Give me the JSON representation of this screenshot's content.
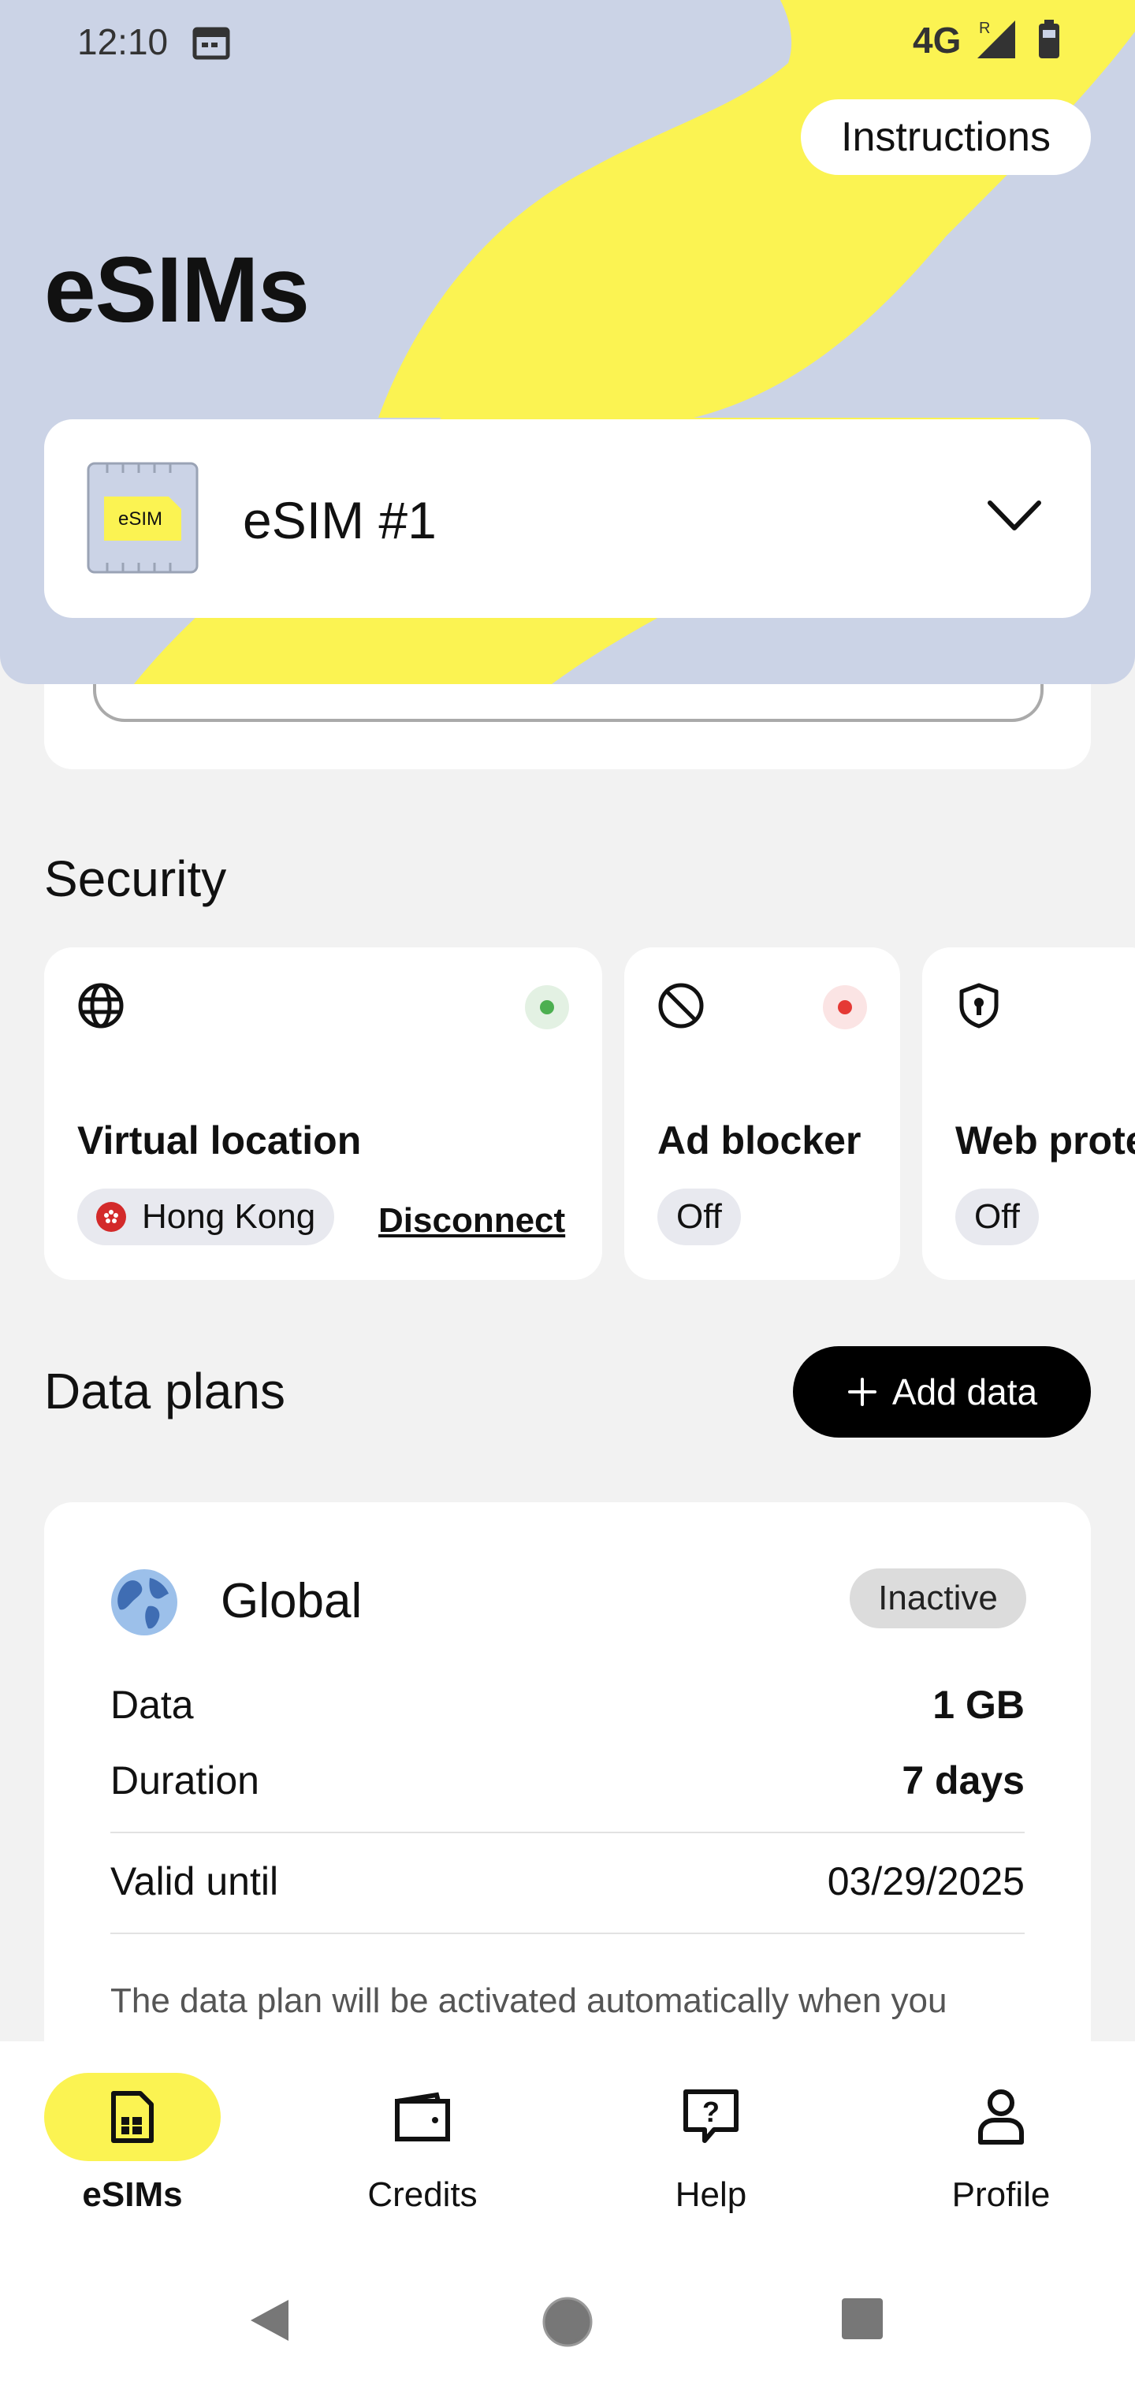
{
  "status_bar": {
    "time": "12:10",
    "network": "4G",
    "roaming": "R"
  },
  "header": {
    "title": "eSIMs",
    "instructions_label": "Instructions"
  },
  "esim_selector": {
    "chip_label": "eSIM",
    "name": "eSIM #1"
  },
  "security": {
    "title": "Security",
    "cards": [
      {
        "label": "Virtual location",
        "status_color": "#4caf50",
        "location": "Hong Kong",
        "action": "Disconnect"
      },
      {
        "label": "Ad blocker",
        "status_color": "#e53935",
        "chip": "Off"
      },
      {
        "label": "Web protection",
        "chip": "Off"
      }
    ]
  },
  "data_plans": {
    "title": "Data plans",
    "add_label": "Add data",
    "plan": {
      "name": "Global",
      "status": "Inactive",
      "rows": [
        {
          "label": "Data",
          "value": "1 GB"
        },
        {
          "label": "Duration",
          "value": "7 days"
        },
        {
          "label": "Valid until",
          "value": "03/29/2025"
        }
      ],
      "note": "The data plan will be activated automatically when you"
    }
  },
  "bottom_nav": {
    "items": [
      {
        "label": "eSIMs",
        "active": true
      },
      {
        "label": "Credits"
      },
      {
        "label": "Help"
      },
      {
        "label": "Profile"
      }
    ]
  },
  "colors": {
    "accent_yellow": "#fbf352",
    "header_blue": "#cbd3e6",
    "active_green": "#4caf50",
    "inactive_red": "#e53935"
  }
}
